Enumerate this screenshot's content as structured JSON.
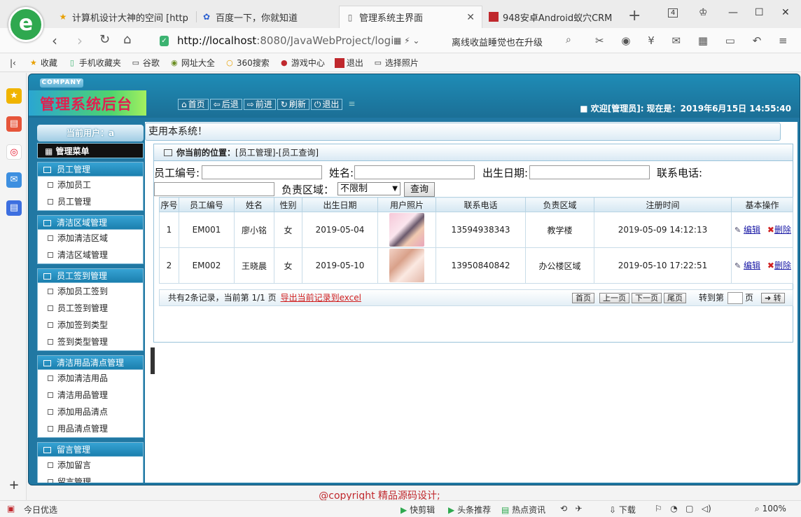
{
  "browser": {
    "tabs": [
      {
        "label": "计算机设计大神的空间 [http",
        "icon": "star-icon"
      },
      {
        "label": "百度一下，你就知道",
        "icon": "baidu-icon"
      },
      {
        "label": "管理系统主界面",
        "icon": "document-icon"
      },
      {
        "label": "948安卓Android蚁穴CRM",
        "icon": "red-square-icon"
      }
    ],
    "tab_count": "4",
    "url_host": "http://localhost",
    "url_path": ":8080/JavaWebProject/logi",
    "promo": "离线收益睡觉也在升级",
    "bookmarks": [
      "收藏",
      "手机收藏夹",
      "谷歌",
      "网址大全",
      "360搜索",
      "游戏中心",
      "退出",
      "选择照片"
    ],
    "status_left": "今日优选",
    "status_items": [
      "快剪辑",
      "头条推荐",
      "热点资讯",
      "下载"
    ],
    "zoom": "100%"
  },
  "app": {
    "company": "COMPANY",
    "title": "管理系统后台",
    "header_buttons": [
      {
        "icon": "home-icon",
        "label": "首页"
      },
      {
        "icon": "back-icon",
        "label": "后退"
      },
      {
        "icon": "forward-icon",
        "label": "前进"
      },
      {
        "icon": "refresh-icon",
        "label": "刷新"
      },
      {
        "icon": "power-icon",
        "label": "退出"
      }
    ],
    "welcome": "■ 欢迎[管理员]:  现在是：2019年6月15日 14:55:40",
    "notice": "吏用本系统！",
    "current_user": "当前用户：a",
    "main_menu": "管理菜单",
    "menu_groups": [
      {
        "title": "员工管理",
        "items": [
          "添加员工",
          "员工管理"
        ]
      },
      {
        "title": "清洁区域管理",
        "items": [
          "添加清洁区域",
          "清洁区域管理"
        ]
      },
      {
        "title": "员工签到管理",
        "items": [
          "添加员工签到",
          "员工签到管理",
          "添加签到类型",
          "签到类型管理"
        ]
      },
      {
        "title": "清洁用品清点管理",
        "items": [
          "添加清洁用品",
          "清洁用品管理",
          "添加用品清点",
          "用品清点管理"
        ]
      },
      {
        "title": "留言管理",
        "items": [
          "添加留言",
          "留言管理"
        ]
      }
    ],
    "location_label": "你当前的位置：",
    "location_path": "[员工管理]-[员工查询]",
    "search": {
      "emp_no_label": "员工编号:",
      "name_label": "姓名:",
      "birth_label": "出生日期:",
      "phone_label": "联系电话:",
      "area_label": "负责区域：",
      "area_value": "不限制",
      "query_button": "查询"
    },
    "table": {
      "headers": [
        "序号",
        "员工编号",
        "姓名",
        "性别",
        "出生日期",
        "用户照片",
        "联系电话",
        "负责区域",
        "注册时间",
        "基本操作"
      ],
      "rows": [
        {
          "idx": "1",
          "emp_no": "EM001",
          "name": "廖小铭",
          "sex": "女",
          "birth": "2019-05-04",
          "phone": "13594938343",
          "area": "教学楼",
          "reg_time": "2019-05-09 14:12:13"
        },
        {
          "idx": "2",
          "emp_no": "EM002",
          "name": "王晓晨",
          "sex": "女",
          "birth": "2019-05-10",
          "phone": "13950840842",
          "area": "办公楼区域",
          "reg_time": "2019-05-10 17:22:51"
        }
      ],
      "edit_label": "编辑",
      "delete_label": "删除"
    },
    "pager": {
      "info": "共有2条记录，当前第 1/1 页",
      "export": "导出当前记录到excel",
      "first": "首页",
      "prev": "上一页",
      "next": "下一页",
      "last": "尾页",
      "goto_prefix": "转到第",
      "goto_suffix": "页",
      "go_button": "转"
    },
    "copyright": "@copyright 精品源码设计;"
  }
}
